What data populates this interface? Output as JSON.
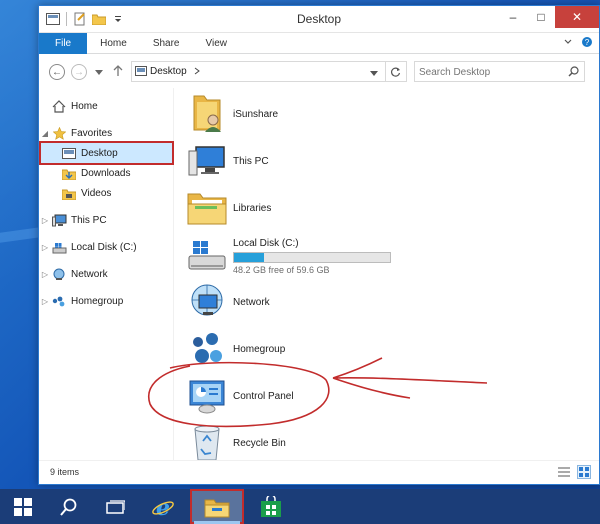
{
  "window": {
    "title": "Desktop"
  },
  "ribbon": {
    "tabs": [
      "File",
      "Home",
      "Share",
      "View"
    ]
  },
  "address": {
    "path": "Desktop",
    "search_placeholder": "Search Desktop"
  },
  "nav": {
    "home": "Home",
    "favorites": "Favorites",
    "desktop": "Desktop",
    "downloads": "Downloads",
    "videos": "Videos",
    "thispc": "This PC",
    "localdisk": "Local Disk (C:)",
    "network": "Network",
    "homegroup": "Homegroup"
  },
  "items": [
    {
      "name": "iSunshare",
      "icon": "user-folder-icon"
    },
    {
      "name": "This PC",
      "icon": "computer-icon"
    },
    {
      "name": "Libraries",
      "icon": "libraries-folder-icon"
    },
    {
      "name": "Local Disk (C:)",
      "icon": "drive-icon",
      "free_text": "48.2 GB free of 59.6 GB",
      "used_fraction": 0.19
    },
    {
      "name": "Network",
      "icon": "network-icon"
    },
    {
      "name": "Homegroup",
      "icon": "homegroup-icon"
    },
    {
      "name": "Control Panel",
      "icon": "control-panel-icon"
    },
    {
      "name": "Recycle Bin",
      "icon": "recycle-bin-icon"
    }
  ],
  "status": {
    "count": "9 items"
  },
  "colors": {
    "accent": "#1979ca",
    "annotation": "#c22c2c",
    "drive_fill": "#26a0da"
  }
}
